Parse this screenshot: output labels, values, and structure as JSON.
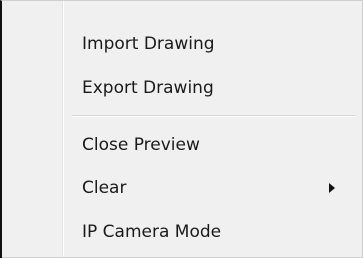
{
  "menu": {
    "items": [
      {
        "label": "Import Drawing"
      },
      {
        "label": "Export Drawing"
      },
      {
        "label": "Close Preview"
      },
      {
        "label": "Clear",
        "submenu_icon": "chevron-right-icon"
      },
      {
        "label": "IP Camera Mode"
      }
    ]
  }
}
